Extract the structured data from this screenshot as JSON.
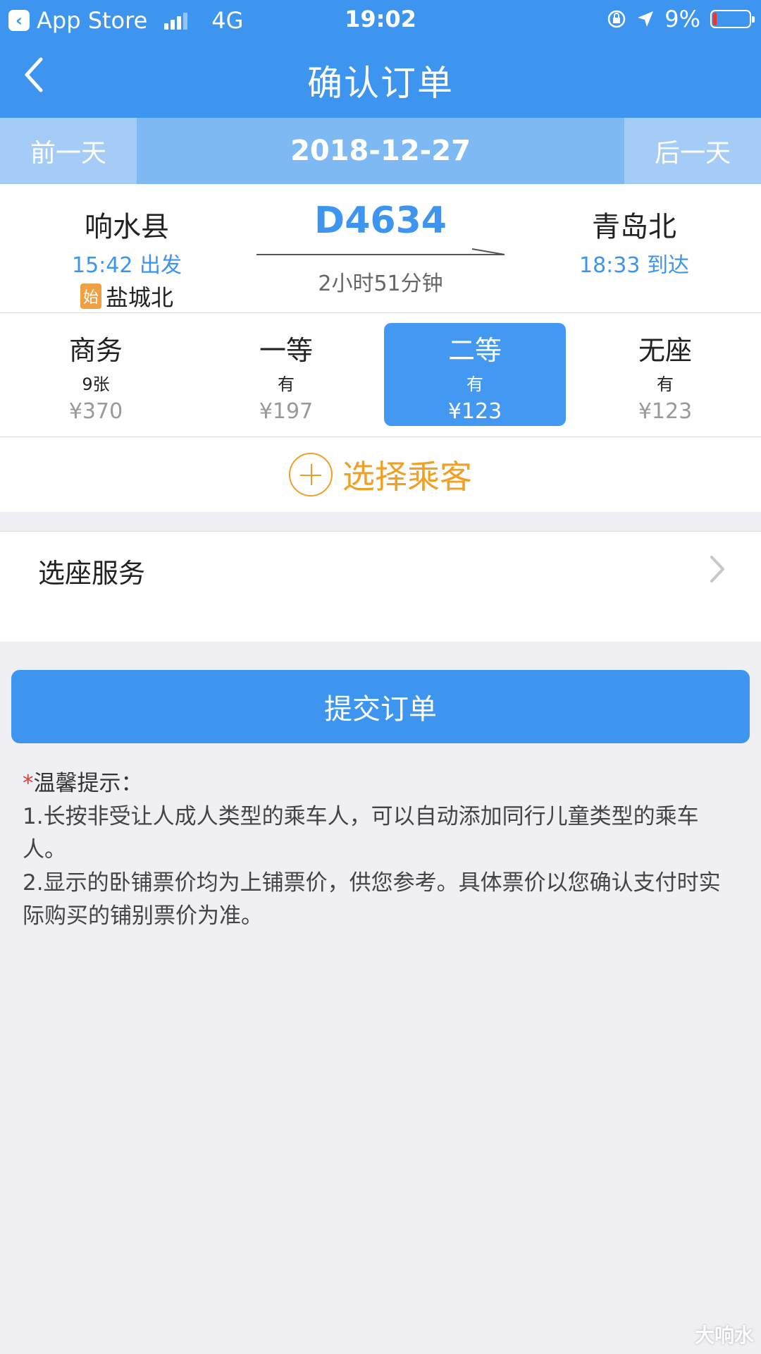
{
  "status_bar": {
    "back_app_label": "App Store",
    "network": "4G",
    "time": "19:02",
    "battery_percent": "9%",
    "battery_level": 0.09,
    "icons": [
      "signal-icon",
      "rotation-lock-icon",
      "location-arrow-icon",
      "battery-icon"
    ]
  },
  "nav": {
    "title": "确认订单",
    "back_icon": "chevron-left-icon"
  },
  "date_bar": {
    "prev_label": "前一天",
    "date": "2018-12-27",
    "next_label": "后一天"
  },
  "train": {
    "number": "D4634",
    "duration": "2小时51分钟",
    "departure": {
      "station": "响水县",
      "time": "15:42 出发",
      "origin_badge": "始",
      "origin_station": "盐城北"
    },
    "arrival": {
      "station": "青岛北",
      "time": "18:33 到达"
    }
  },
  "seats": [
    {
      "name": "商务",
      "availability": "9张",
      "price": "¥370",
      "selected": false
    },
    {
      "name": "一等",
      "availability": "有",
      "price": "¥197",
      "selected": false
    },
    {
      "name": "二等",
      "availability": "有",
      "price": "¥123",
      "selected": true
    },
    {
      "name": "无座",
      "availability": "有",
      "price": "¥123",
      "selected": false
    }
  ],
  "add_passenger": {
    "label": "选择乘客",
    "icon": "plus-circle-icon"
  },
  "seat_service": {
    "label": "选座服务",
    "icon": "chevron-right-icon"
  },
  "submit_label": "提交订单",
  "tips": {
    "star": "*",
    "title": "温馨提示：",
    "lines": [
      "1.长按非受让人成人类型的乘车人，可以自动添加同行儿童类型的乘车人。",
      "2.显示的卧铺票价均为上铺票价，供您参考。具体票价以您确认支付时实际购买的铺别票价为准。"
    ]
  },
  "watermark": "大响水",
  "colors": {
    "primary": "#3d95f0",
    "accent_orange": "#f0a024",
    "background": "#efeff4",
    "date_bar": "#7eb9f4",
    "date_side": "#a4ccf7"
  }
}
